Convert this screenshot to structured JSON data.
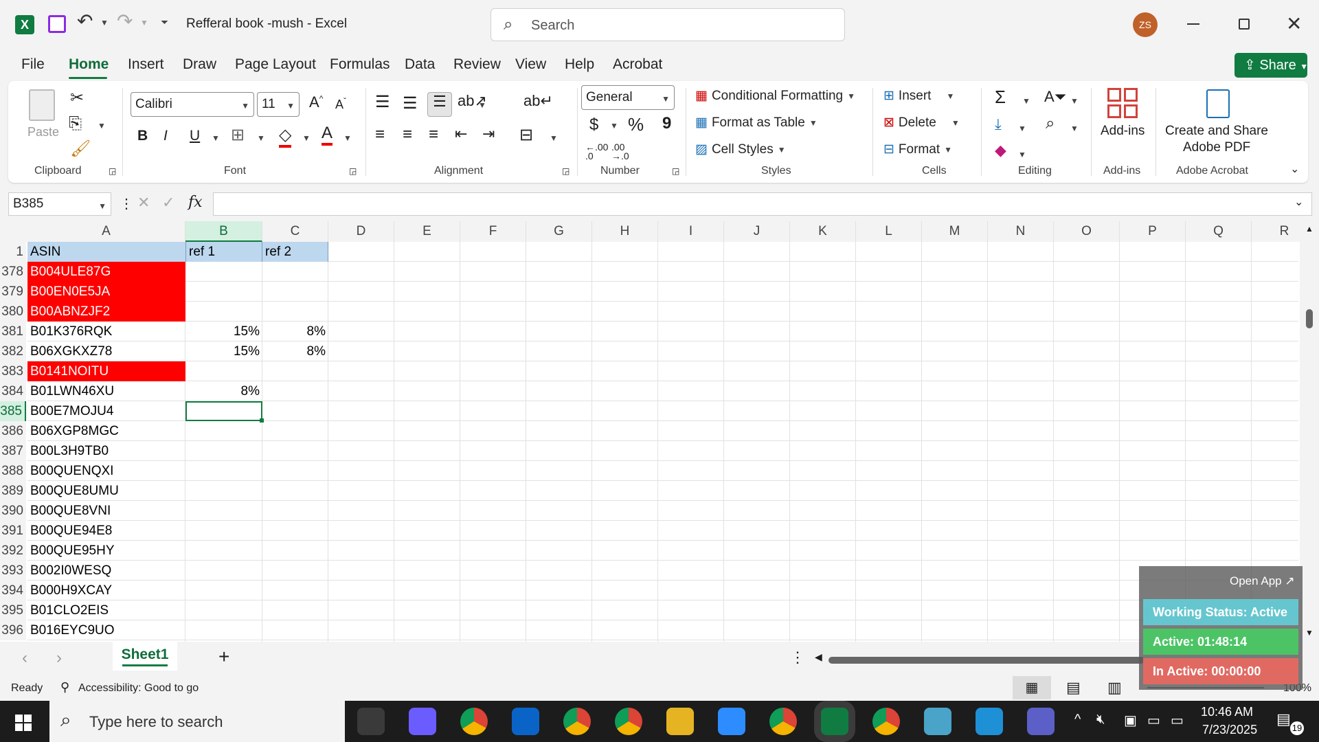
{
  "window": {
    "app_icon": "excel-logo",
    "title": "Refferal book -mush  -  Excel",
    "search_placeholder": "Search",
    "user_initials": "ZS"
  },
  "menu": {
    "tabs": [
      "File",
      "Home",
      "Insert",
      "Draw",
      "Page Layout",
      "Formulas",
      "Data",
      "Review",
      "View",
      "Help",
      "Acrobat"
    ],
    "active_tab": "Home",
    "share_label": "Share"
  },
  "ribbon": {
    "clipboard": {
      "paste_label": "Paste",
      "group_label": "Clipboard"
    },
    "font": {
      "font_name": "Calibri",
      "font_size": "11",
      "group_label": "Font",
      "bold": "B",
      "italic": "I",
      "underline": "U"
    },
    "alignment": {
      "group_label": "Alignment"
    },
    "number": {
      "format": "General",
      "currency": "$",
      "percent": "%",
      "comma": "9",
      "group_label": "Number",
      "inc_decimal": ".00",
      "dec_decimal": ".00"
    },
    "styles": {
      "conditional_formatting": "Conditional Formatting",
      "format_as_table": "Format as Table",
      "cell_styles": "Cell Styles",
      "group_label": "Styles"
    },
    "cells": {
      "insert": "Insert",
      "delete": "Delete",
      "format": "Format",
      "group_label": "Cells"
    },
    "editing": {
      "group_label": "Editing"
    },
    "addins": {
      "label": "Add-ins",
      "group_label": "Add-ins"
    },
    "acrobat": {
      "label_line1": "Create and Share",
      "label_line2": "Adobe PDF",
      "group_label": "Adobe Acrobat"
    }
  },
  "formula_bar": {
    "name_box": "B385",
    "fx": "fx",
    "formula": ""
  },
  "sheet": {
    "columns": [
      "A",
      "B",
      "C",
      "D",
      "E",
      "F",
      "G",
      "H",
      "I",
      "J",
      "K",
      "L",
      "M",
      "N",
      "O",
      "P",
      "Q",
      "R"
    ],
    "rows": [
      {
        "num": "1",
        "a": "ASIN",
        "b": "ref 1",
        "c": "ref 2",
        "header": true
      },
      {
        "num": "378",
        "a": "B004ULE87G",
        "b": "",
        "c": "",
        "red": true
      },
      {
        "num": "379",
        "a": "B00EN0E5JA",
        "b": "",
        "c": "",
        "red": true
      },
      {
        "num": "380",
        "a": "B00ABNZJF2",
        "b": "",
        "c": "",
        "red": true
      },
      {
        "num": "381",
        "a": "B01K376RQK",
        "b": "15%",
        "c": "8%"
      },
      {
        "num": "382",
        "a": "B06XGKXZ78",
        "b": "15%",
        "c": "8%"
      },
      {
        "num": "383",
        "a": "B0141NOITU",
        "b": "",
        "c": "",
        "red": true
      },
      {
        "num": "384",
        "a": "B01LWN46XU",
        "b": "8%",
        "c": ""
      },
      {
        "num": "385",
        "a": "B00E7MOJU4",
        "b": "",
        "c": "",
        "selected": true
      },
      {
        "num": "386",
        "a": "B06XGP8MGC",
        "b": "",
        "c": ""
      },
      {
        "num": "387",
        "a": "B00L3H9TB0",
        "b": "",
        "c": ""
      },
      {
        "num": "388",
        "a": "B00QUENQXI",
        "b": "",
        "c": ""
      },
      {
        "num": "389",
        "a": "B00QUE8UMU",
        "b": "",
        "c": ""
      },
      {
        "num": "390",
        "a": "B00QUE8VNI",
        "b": "",
        "c": ""
      },
      {
        "num": "391",
        "a": "B00QUE94E8",
        "b": "",
        "c": ""
      },
      {
        "num": "392",
        "a": "B00QUE95HY",
        "b": "",
        "c": ""
      },
      {
        "num": "393",
        "a": "B002I0WESQ",
        "b": "",
        "c": ""
      },
      {
        "num": "394",
        "a": "B000H9XCAY",
        "b": "",
        "c": ""
      },
      {
        "num": "395",
        "a": "B01CLO2EIS",
        "b": "",
        "c": ""
      },
      {
        "num": "396",
        "a": "B016EYC9UO",
        "b": "",
        "c": ""
      }
    ],
    "tab_name": "Sheet1"
  },
  "status": {
    "ready": "Ready",
    "accessibility": "Accessibility: Good to go",
    "zoom": "100%"
  },
  "widget": {
    "open_app": "Open App ↗",
    "working_status": "Working Status: Active",
    "active": "Active: 01:48:14",
    "inactive": "In Active: 00:00:00"
  },
  "taskbar": {
    "search_placeholder": "Type here to search",
    "time": "10:46 AM",
    "date": "7/23/2025",
    "notifications": "19",
    "apps": [
      "task-view-icon",
      "copilot-icon",
      "chrome-icon",
      "outlook-icon",
      "chrome-icon",
      "chrome-icon",
      "file-explorer-icon",
      "zoom-icon",
      "chrome-icon",
      "excel-icon",
      "chrome-icon",
      "vscode-icon",
      "edge-icon",
      "teams-icon"
    ]
  },
  "colors": {
    "accent": "#107c41",
    "red_fill": "#ff0000",
    "header_fill": "#bdd7ee",
    "selected_header": "#d3f0e0"
  }
}
